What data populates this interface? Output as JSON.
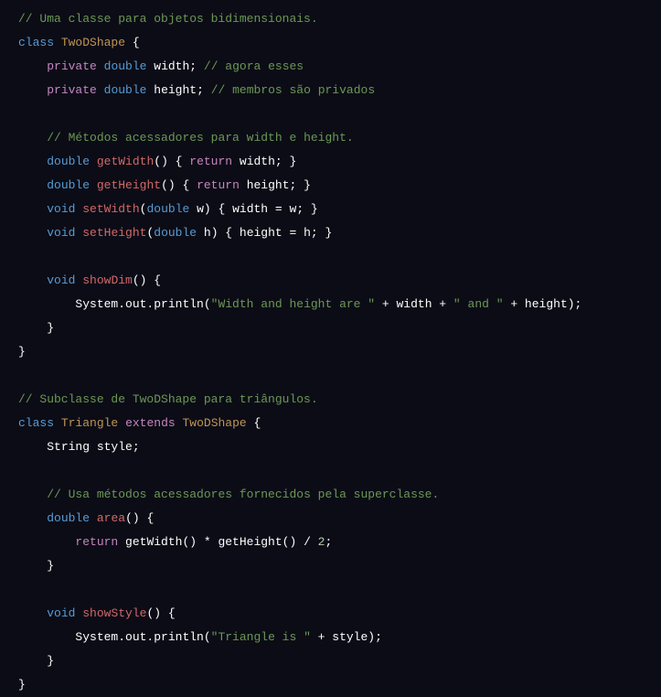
{
  "lines": {
    "l1_comment": "// Uma classe para objetos bidimensionais.",
    "l2_class": "class",
    "l2_name": "TwoDShape",
    "l2_brace": " {",
    "l3_private": "private",
    "l3_type": "double",
    "l3_var": "width;",
    "l3_comment": "// agora esses",
    "l4_private": "private",
    "l4_type": "double",
    "l4_var": "height;",
    "l4_comment": "// membros são privados",
    "l6_comment": "// Métodos acessadores para width e height.",
    "l7_type": "double",
    "l7_method": "getWidth",
    "l7_rest1": "() { ",
    "l7_return": "return",
    "l7_rest2": " width; }",
    "l8_type": "double",
    "l8_method": "getHeight",
    "l8_rest1": "() { ",
    "l8_return": "return",
    "l8_rest2": " height; }",
    "l9_void": "void",
    "l9_method": "setWidth",
    "l9_p1": "(",
    "l9_ptype": "double",
    "l9_pname": " w) { width = w; }",
    "l10_void": "void",
    "l10_method": "setHeight",
    "l10_p1": "(",
    "l10_ptype": "double",
    "l10_pname": " h) { height = h; }",
    "l12_void": "void",
    "l12_method": "showDim",
    "l12_rest": "() {",
    "l13_call": "System.out.println(",
    "l13_str1": "\"Width and height are \"",
    "l13_mid1": " + width + ",
    "l13_str2": "\" and \"",
    "l13_mid2": " + height);",
    "l14_brace": "}",
    "l15_brace": "}",
    "l18_comment": "// Subclasse de TwoDShape para triângulos.",
    "l19_class": "class",
    "l19_name": "Triangle",
    "l19_extends": "extends",
    "l19_super": "TwoDShape",
    "l19_brace": " {",
    "l20_decl": "String style;",
    "l22_comment": "// Usa métodos acessadores fornecidos pela superclasse.",
    "l23_type": "double",
    "l23_method": "area",
    "l23_rest": "() {",
    "l24_return": "return",
    "l24_expr1": " getWidth() * getHeight() / ",
    "l24_num": "2",
    "l24_semi": ";",
    "l25_brace": "}",
    "l27_void": "void",
    "l27_method": "showStyle",
    "l27_rest": "() {",
    "l28_call": "System.out.println(",
    "l28_str": "\"Triangle is \"",
    "l28_rest": " + style);",
    "l29_brace": "}",
    "l30_brace": "}"
  }
}
